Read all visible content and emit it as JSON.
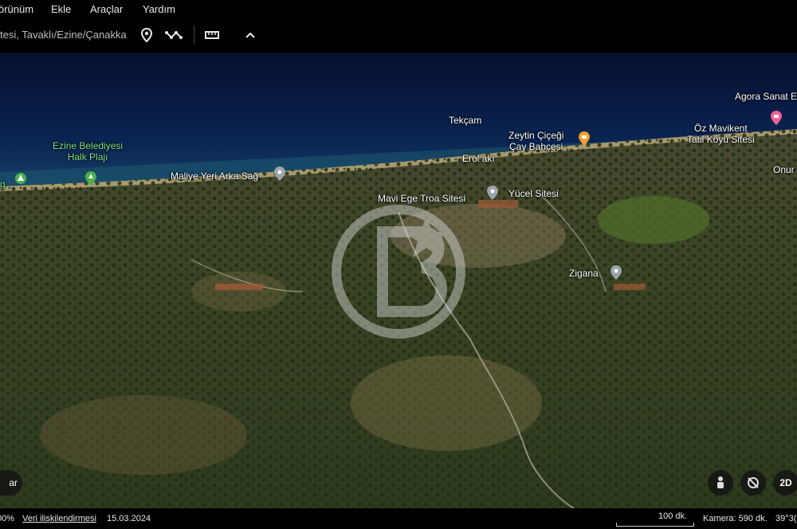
{
  "menu": {
    "items": [
      "örünüm",
      "Ekle",
      "Araçlar",
      "Yardım"
    ]
  },
  "toolbar": {
    "search_value": "tesi, Tavaklı/Ezine/Çanakka",
    "icons": [
      "placemark-icon",
      "path-icon",
      "ruler-icon",
      "chevron-up-icon"
    ]
  },
  "map": {
    "places": {
      "tekcam": "Tekçam",
      "agora": "Agora Sanat E",
      "zeytin": "Zeytin Çiçeği\nÇay Bahçesi",
      "oz_mavikent": "Öz Mavikent\nTatil Köyü Sitesi",
      "ezine_plaj": "Ezine Belediyesi\nHalk Plajı",
      "erol_aki": "Erol akı",
      "onur": "Onur",
      "maliye": "Maliye Yeri Arka Sağ",
      "mavi_ege": "Mavi Ege Troa Sitesi",
      "yucel": "Yücel Sitesi",
      "zigana": "Zigana",
      "left_edge": "g"
    },
    "controls": {
      "left": "ar",
      "view_mode": "2D"
    }
  },
  "status": {
    "zoom_pct": "00%",
    "data_attribution": "Veri ilişkilendirmesi",
    "date": "15.03.2024",
    "scale": "100 dk.",
    "camera": "Kamera: 590 dk.",
    "coords": "39°3("
  },
  "colors": {
    "sea_deep": "#071a40",
    "sea_shallow": "#1f5c7a",
    "land_dark": "#2d3a1e",
    "land_light": "#8a7a55",
    "place_green": "#7ee08a",
    "pin_grey": "#9aa4ad",
    "pin_orange": "#f0a030",
    "pin_pink": "#f06292"
  }
}
